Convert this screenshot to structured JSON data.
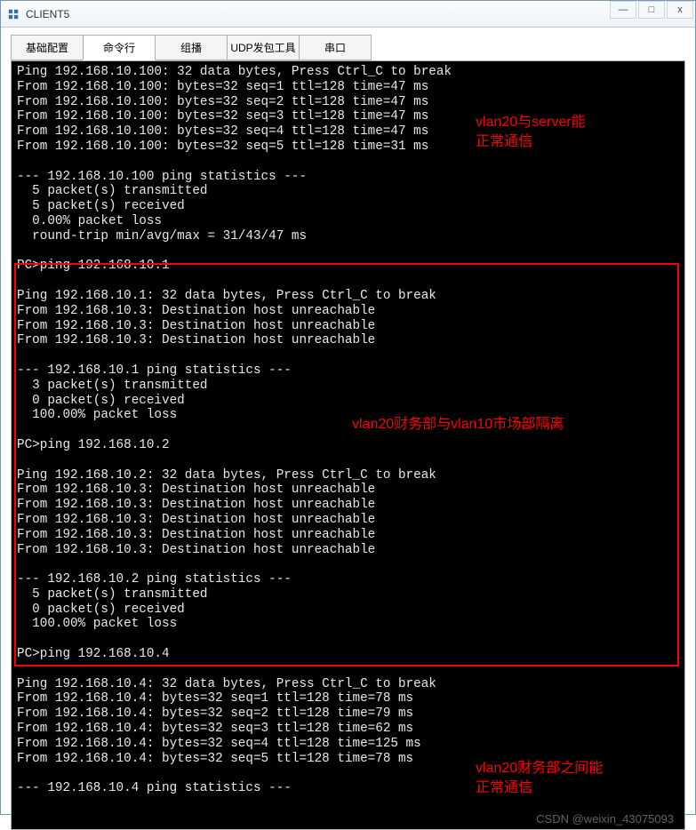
{
  "window": {
    "title": "CLIENT5",
    "icon_name": "app-icon"
  },
  "tabs": {
    "t0": "基础配置",
    "t1": "命令行",
    "t2": "组播",
    "t3": "UDP发包工具",
    "t4": "串口"
  },
  "annotations": {
    "a1_line1": "vlan20与server能",
    "a1_line2": "正常通信",
    "a2": "vlan20财务部与vlan10市场部隔离",
    "a3_line1": "vlan20财务部之间能",
    "a3_line2": "正常通信"
  },
  "terminal": {
    "block1": [
      "Ping 192.168.10.100: 32 data bytes, Press Ctrl_C to break",
      "From 192.168.10.100: bytes=32 seq=1 ttl=128 time=47 ms",
      "From 192.168.10.100: bytes=32 seq=2 ttl=128 time=47 ms",
      "From 192.168.10.100: bytes=32 seq=3 ttl=128 time=47 ms",
      "From 192.168.10.100: bytes=32 seq=4 ttl=128 time=47 ms",
      "From 192.168.10.100: bytes=32 seq=5 ttl=128 time=31 ms",
      "",
      "--- 192.168.10.100 ping statistics ---",
      "  5 packet(s) transmitted",
      "  5 packet(s) received",
      "  0.00% packet loss",
      "  round-trip min/avg/max = 31/43/47 ms",
      ""
    ],
    "block2": [
      "PC>ping 192.168.10.1",
      "",
      "Ping 192.168.10.1: 32 data bytes, Press Ctrl_C to break",
      "From 192.168.10.3: Destination host unreachable",
      "From 192.168.10.3: Destination host unreachable",
      "From 192.168.10.3: Destination host unreachable",
      "",
      "--- 192.168.10.1 ping statistics ---",
      "  3 packet(s) transmitted",
      "  0 packet(s) received",
      "  100.00% packet loss",
      "",
      "PC>ping 192.168.10.2",
      "",
      "Ping 192.168.10.2: 32 data bytes, Press Ctrl_C to break",
      "From 192.168.10.3: Destination host unreachable",
      "From 192.168.10.3: Destination host unreachable",
      "From 192.168.10.3: Destination host unreachable",
      "From 192.168.10.3: Destination host unreachable",
      "From 192.168.10.3: Destination host unreachable",
      "",
      "--- 192.168.10.2 ping statistics ---",
      "  5 packet(s) transmitted",
      "  0 packet(s) received",
      "  100.00% packet loss",
      ""
    ],
    "block3": [
      "PC>ping 192.168.10.4",
      "",
      "Ping 192.168.10.4: 32 data bytes, Press Ctrl_C to break",
      "From 192.168.10.4: bytes=32 seq=1 ttl=128 time=78 ms",
      "From 192.168.10.4: bytes=32 seq=2 ttl=128 time=79 ms",
      "From 192.168.10.4: bytes=32 seq=3 ttl=128 time=62 ms",
      "From 192.168.10.4: bytes=32 seq=4 ttl=128 time=125 ms",
      "From 192.168.10.4: bytes=32 seq=5 ttl=128 time=78 ms",
      "",
      "--- 192.168.10.4 ping statistics ---"
    ]
  },
  "watermark": "CSDN @weixin_43075093"
}
